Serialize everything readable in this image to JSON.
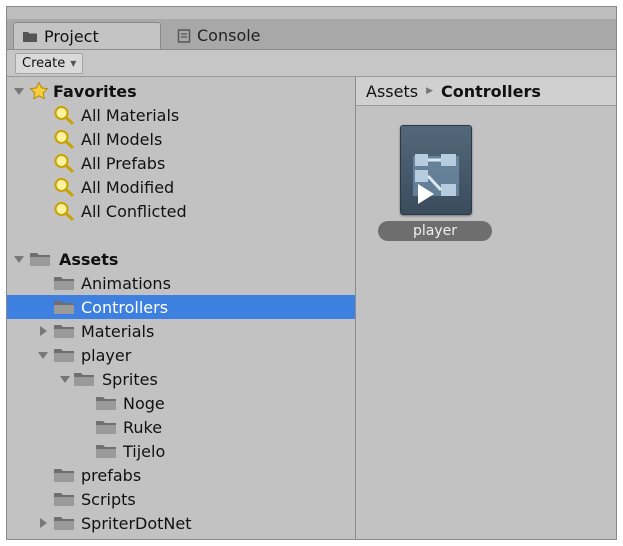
{
  "tabs": [
    {
      "label": "Project",
      "icon": "folder-icon"
    },
    {
      "label": "Console",
      "icon": "console-icon"
    }
  ],
  "toolbar": {
    "create_label": "Create",
    "create_arrow": "▼"
  },
  "favorites": {
    "label": "Favorites",
    "items": [
      "All Materials",
      "All Models",
      "All Prefabs",
      "All Modified",
      "All Conflicted"
    ]
  },
  "assets": {
    "label": "Assets",
    "items": [
      {
        "label": "Animations",
        "depth": 1,
        "expander": "none"
      },
      {
        "label": "Controllers",
        "depth": 1,
        "expander": "none",
        "selected": true
      },
      {
        "label": "Materials",
        "depth": 1,
        "expander": "collapsed"
      },
      {
        "label": "player",
        "depth": 1,
        "expander": "expanded"
      },
      {
        "label": "Sprites",
        "depth": 2,
        "expander": "expanded"
      },
      {
        "label": "Noge",
        "depth": 3,
        "expander": "none"
      },
      {
        "label": "Ruke",
        "depth": 3,
        "expander": "none"
      },
      {
        "label": "Tijelo",
        "depth": 3,
        "expander": "none"
      },
      {
        "label": "prefabs",
        "depth": 1,
        "expander": "none"
      },
      {
        "label": "Scripts",
        "depth": 1,
        "expander": "none"
      },
      {
        "label": "SpriterDotNet",
        "depth": 1,
        "expander": "collapsed"
      }
    ]
  },
  "breadcrumb": {
    "root": "Assets",
    "separator": "▶",
    "current": "Controllers"
  },
  "asset": {
    "name": "player",
    "icon": "animator-controller-icon"
  },
  "colors": {
    "selection": "#3d80df",
    "panel": "#c2c2c2"
  }
}
